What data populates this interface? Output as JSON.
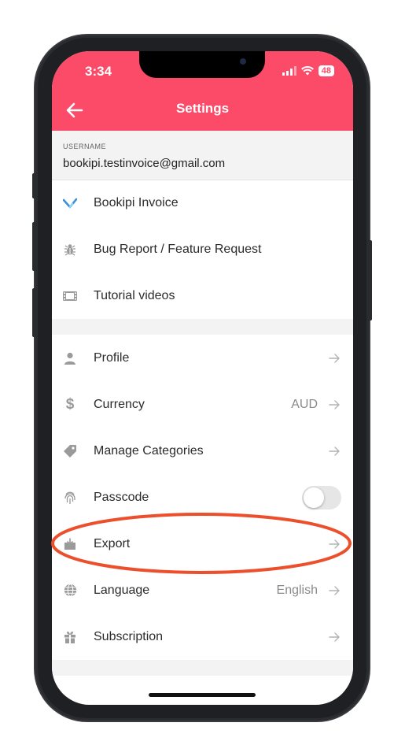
{
  "status_bar": {
    "time": "3:34",
    "battery": "48"
  },
  "header": {
    "title": "Settings"
  },
  "username": {
    "label": "USERNAME",
    "value": "bookipi.testinvoice@gmail.com"
  },
  "section1": [
    {
      "label": "Bookipi Invoice",
      "icon": "bookipi-logo-icon"
    },
    {
      "label": "Bug Report / Feature Request",
      "icon": "bug-icon"
    },
    {
      "label": "Tutorial videos",
      "icon": "film-icon"
    }
  ],
  "section2": [
    {
      "label": "Profile",
      "icon": "person-icon"
    },
    {
      "label": "Currency",
      "value": "AUD",
      "icon": "dollar-icon"
    },
    {
      "label": "Manage Categories",
      "icon": "tag-icon"
    },
    {
      "label": "Passcode",
      "icon": "fingerprint-icon",
      "toggle_on": false
    },
    {
      "label": "Export",
      "icon": "export-icon"
    },
    {
      "label": "Language",
      "value": "English",
      "icon": "globe-icon"
    },
    {
      "label": "Subscription",
      "icon": "gift-icon"
    }
  ],
  "colors": {
    "header": "#fc4b68",
    "highlight": "#ec4f2b",
    "section_bg": "#f3f3f3",
    "icon": "#9a9a9a",
    "bookipi_logo": "#3c8fd8"
  }
}
